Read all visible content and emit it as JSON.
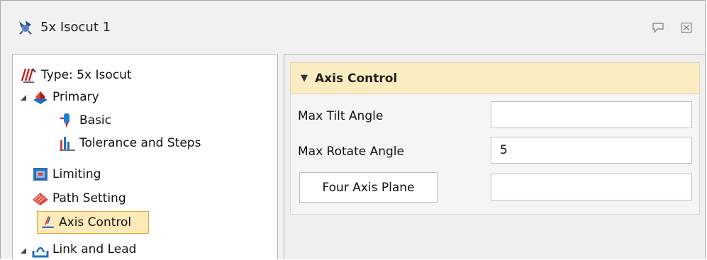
{
  "window": {
    "title": "5x Isocut 1"
  },
  "tree": {
    "items": [
      {
        "label": "Type: 5x Isocut",
        "icon": "toolpath-type-icon"
      },
      {
        "label": "Primary",
        "icon": "primary-icon"
      },
      {
        "label": "Basic",
        "icon": "basic-icon"
      },
      {
        "label": "Tolerance and Steps",
        "icon": "tolerance-icon"
      },
      {
        "label": "Limiting",
        "icon": "limiting-icon"
      },
      {
        "label": "Path Setting",
        "icon": "path-setting-icon"
      },
      {
        "label": "Axis Control",
        "icon": "axis-control-icon"
      },
      {
        "label": "Link and Lead",
        "icon": "link-lead-icon"
      }
    ],
    "selected": "Axis Control"
  },
  "axis_control": {
    "header": "Axis Control",
    "max_tilt_label": "Max Tilt Angle",
    "max_tilt_value": "",
    "max_rotate_label": "Max Rotate Angle",
    "max_rotate_value": "5",
    "four_axis_button": "Four Axis Plane",
    "four_axis_value": ""
  },
  "colors": {
    "section_header_bg": "#fbecc1",
    "selection_bg": "#fdeab8",
    "selection_border": "#e5a53a"
  }
}
